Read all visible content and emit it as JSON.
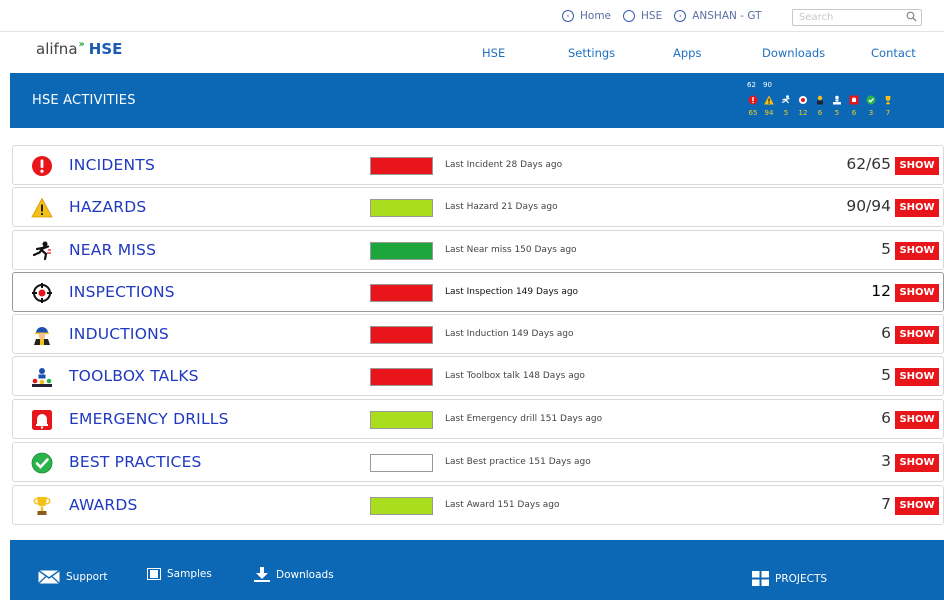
{
  "topbar": {
    "links": [
      {
        "label": "Home",
        "glyph": "‹"
      },
      {
        "label": "HSE",
        "glyph": ""
      },
      {
        "label": "ANSHAN - GT",
        "glyph": "›"
      }
    ],
    "search_placeholder": "Search"
  },
  "brand": {
    "alif": "alifna",
    "hse": "HSE"
  },
  "nav": {
    "items": [
      "HSE",
      "Settings",
      "Apps",
      "Downloads",
      "Contact"
    ]
  },
  "banner": {
    "title": "HSE ACTIVITIES"
  },
  "summary": {
    "top": [
      "62",
      "90"
    ],
    "icons": [
      "incident-icon",
      "hazard-icon",
      "near-miss-icon",
      "inspection-icon",
      "induction-icon",
      "toolbox-icon",
      "emergency-icon",
      "best-practice-icon",
      "award-icon"
    ],
    "totals": [
      "65",
      "94",
      "5",
      "12",
      "6",
      "5",
      "6",
      "3",
      "7"
    ]
  },
  "activities": [
    {
      "title": "INCIDENTS",
      "icon": "incident-icon",
      "status_color": "#e8161b",
      "last": "Last Incident 28 Days ago",
      "count": "62/65",
      "action": "SHOW"
    },
    {
      "title": "HAZARDS",
      "icon": "hazard-icon",
      "status_color": "#aadd1e",
      "last": "Last Hazard 21 Days ago",
      "count": "90/94",
      "action": "SHOW"
    },
    {
      "title": "NEAR MISS",
      "icon": "near-miss-icon",
      "status_color": "#1ca63b",
      "last": "Last Near miss 150 Days ago",
      "count": "5",
      "action": "SHOW"
    },
    {
      "title": "INSPECTIONS",
      "icon": "inspection-icon",
      "status_color": "#e8161b",
      "last": "Last Inspection 149 Days ago",
      "count": "12",
      "action": "SHOW"
    },
    {
      "title": "INDUCTIONS",
      "icon": "induction-icon",
      "status_color": "#e8161b",
      "last": "Last Induction 149 Days ago",
      "count": "6",
      "action": "SHOW"
    },
    {
      "title": "TOOLBOX TALKS",
      "icon": "toolbox-icon",
      "status_color": "#e8161b",
      "last": "Last Toolbox talk 148 Days ago",
      "count": "5",
      "action": "SHOW"
    },
    {
      "title": "EMERGENCY DRILLS",
      "icon": "emergency-icon",
      "status_color": "#aadd1e",
      "last": "Last Emergency drill 151 Days ago",
      "count": "6",
      "action": "SHOW"
    },
    {
      "title": "BEST PRACTICES",
      "icon": "best-practice-icon",
      "status_color": "#ffffff",
      "last": "Last Best practice 151 Days ago",
      "count": "3",
      "action": "SHOW"
    },
    {
      "title": "AWARDS",
      "icon": "award-icon",
      "status_color": "#aadd1e",
      "last": "Last Award 151 Days ago",
      "count": "7",
      "action": "SHOW"
    }
  ],
  "footer": {
    "support": "Support",
    "samples": "Samples",
    "downloads": "Downloads",
    "projects": "PROJECTS"
  },
  "colors": {
    "brand_blue": "#0c68b5",
    "title_blue": "#2039c0",
    "show_red": "#e8161b"
  }
}
